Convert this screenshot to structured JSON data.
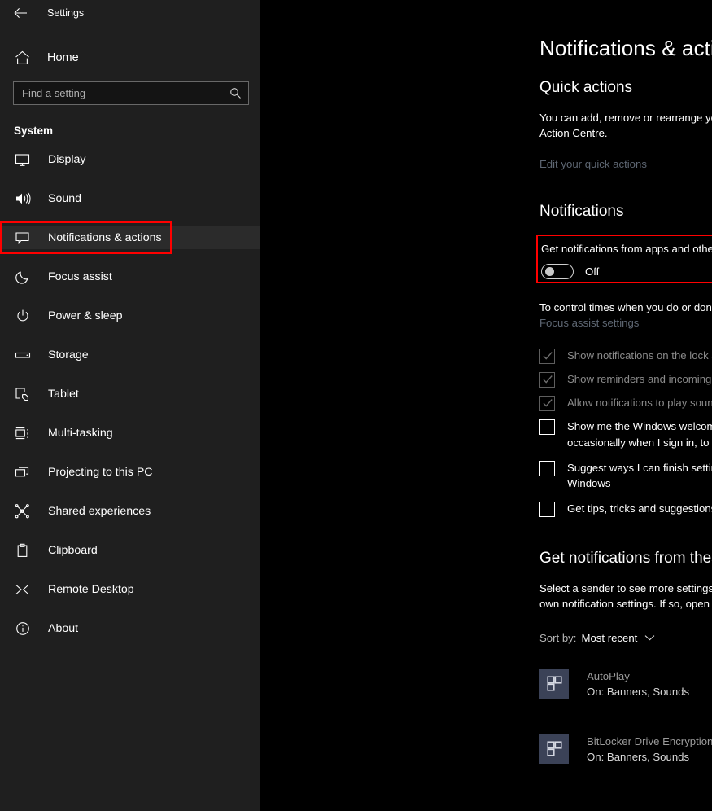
{
  "window": {
    "title": "Settings",
    "back_icon": "back-arrow-icon"
  },
  "sidebar": {
    "home": {
      "label": "Home",
      "icon": "home-icon"
    },
    "search": {
      "placeholder": "Find a setting",
      "value": "",
      "icon": "search-icon"
    },
    "category": "System",
    "items": [
      {
        "label": "Display",
        "icon": "monitor-icon",
        "selected": false
      },
      {
        "label": "Sound",
        "icon": "speaker-icon",
        "selected": false
      },
      {
        "label": "Notifications & actions",
        "icon": "speech-bubble-icon",
        "selected": true
      },
      {
        "label": "Focus assist",
        "icon": "moon-icon",
        "selected": false
      },
      {
        "label": "Power & sleep",
        "icon": "power-icon",
        "selected": false
      },
      {
        "label": "Storage",
        "icon": "drive-icon",
        "selected": false
      },
      {
        "label": "Tablet",
        "icon": "tablet-hand-icon",
        "selected": false
      },
      {
        "label": "Multi-tasking",
        "icon": "multitask-icon",
        "selected": false
      },
      {
        "label": "Projecting to this PC",
        "icon": "project-screen-icon",
        "selected": false
      },
      {
        "label": "Shared experiences",
        "icon": "share-nodes-icon",
        "selected": false
      },
      {
        "label": "Clipboard",
        "icon": "clipboard-icon",
        "selected": false
      },
      {
        "label": "Remote Desktop",
        "icon": "remote-desktop-icon",
        "selected": false
      },
      {
        "label": "About",
        "icon": "info-circle-icon",
        "selected": false
      }
    ]
  },
  "main": {
    "page_title": "Notifications & actions",
    "quick_actions": {
      "heading": "Quick actions",
      "description": "You can add, remove or rearrange your quick actions directly in the Action Centre.",
      "link": "Edit your quick actions"
    },
    "notifications": {
      "heading": "Notifications",
      "master_toggle": {
        "label": "Get notifications from apps and other senders",
        "state": "Off",
        "on": false,
        "highlighted": true
      },
      "hint": "To control times when you do or don't get notifications, try Focus assist.",
      "hint_link": "Focus assist settings",
      "checkboxes": [
        {
          "label": "Show notifications on the lock screen",
          "checked": true,
          "disabled": true
        },
        {
          "label": "Show reminders and incoming VoIP calls on the lock screen",
          "checked": true,
          "disabled": true
        },
        {
          "label": "Allow notifications to play sounds",
          "checked": true,
          "disabled": true
        },
        {
          "label": "Show me the Windows welcome experience after updates and occasionally when I sign in, to highlight what's new and suggested",
          "checked": false,
          "disabled": false
        },
        {
          "label": "Suggest ways I can finish setting up my device to get the most out of Windows",
          "checked": false,
          "disabled": false
        },
        {
          "label": "Get tips, tricks and suggestions as you use Windows",
          "checked": false,
          "disabled": false
        }
      ]
    },
    "apps_section": {
      "heading": "Get notifications from these apps",
      "description": "Select a sender to see more settings. Some senders might also have their own notification settings. If so, open the sender to change them.",
      "sort_label": "Sort by:",
      "sort_value": "Most recent",
      "apps": [
        {
          "name": "AutoPlay",
          "status": "On: Banners, Sounds",
          "toggle_state": "On",
          "on": true,
          "icon": "windows-app-icon"
        },
        {
          "name": "BitLocker Drive Encryption",
          "status": "On: Banners, Sounds",
          "toggle_state": "On",
          "on": true,
          "icon": "windows-app-icon"
        }
      ]
    }
  },
  "colors": {
    "sidebar_bg": "#1f1f1f",
    "main_bg": "#000000",
    "highlight": "#ff0000",
    "link": "#5e6773",
    "app_icon_bg": "#3b4257"
  }
}
